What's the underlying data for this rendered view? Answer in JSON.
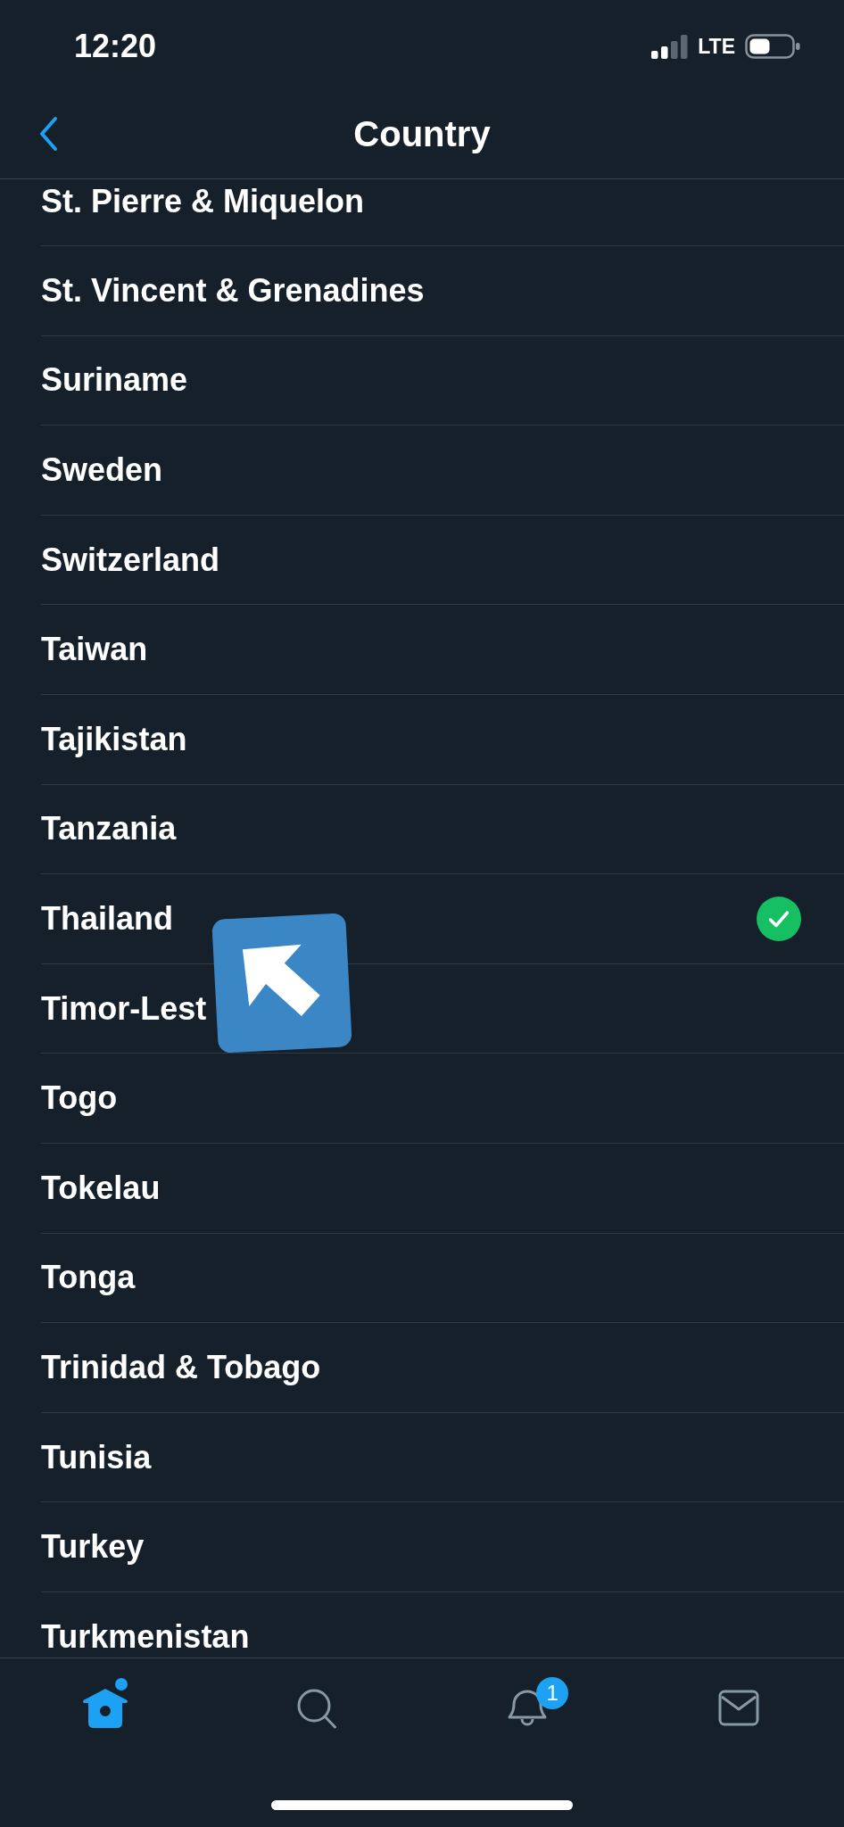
{
  "status_bar": {
    "time": "12:20",
    "network": "LTE"
  },
  "nav_bar": {
    "title": "Country"
  },
  "countries": [
    {
      "name": "St. Pierre & Miquelon",
      "selected": false
    },
    {
      "name": "St. Vincent & Grenadines",
      "selected": false
    },
    {
      "name": "Suriname",
      "selected": false
    },
    {
      "name": "Sweden",
      "selected": false
    },
    {
      "name": "Switzerland",
      "selected": false
    },
    {
      "name": "Taiwan",
      "selected": false
    },
    {
      "name": "Tajikistan",
      "selected": false
    },
    {
      "name": "Tanzania",
      "selected": false
    },
    {
      "name": "Thailand",
      "selected": true
    },
    {
      "name": "Timor-Lest",
      "selected": false
    },
    {
      "name": "Togo",
      "selected": false
    },
    {
      "name": "Tokelau",
      "selected": false
    },
    {
      "name": "Tonga",
      "selected": false
    },
    {
      "name": "Trinidad & Tobago",
      "selected": false
    },
    {
      "name": "Tunisia",
      "selected": false
    },
    {
      "name": "Turkey",
      "selected": false
    },
    {
      "name": "Turkmenistan",
      "selected": false
    }
  ],
  "tab_bar": [
    {
      "kind": "home",
      "selected": true,
      "dot": true
    },
    {
      "kind": "search",
      "selected": false,
      "dot": false
    },
    {
      "kind": "notifications",
      "selected": false,
      "dot": false,
      "badge": "1"
    },
    {
      "kind": "messages",
      "selected": false,
      "dot": false
    }
  ]
}
